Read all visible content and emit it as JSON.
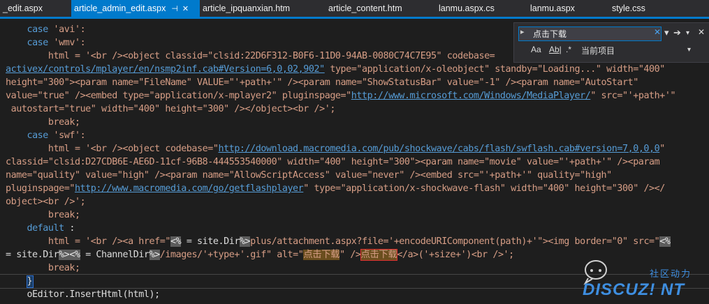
{
  "tabs": [
    {
      "label": "_edit.aspx",
      "active": false
    },
    {
      "label": "article_admin_edit.aspx",
      "active": true,
      "pin": "⊣",
      "close": "✕"
    },
    {
      "label": "article_ipquanxian.htm",
      "active": false
    },
    {
      "label": "article_content.htm",
      "active": false
    },
    {
      "label": "lanmu.aspx.cs",
      "active": false
    },
    {
      "label": "lanmu.aspx",
      "active": false
    },
    {
      "label": "style.css",
      "active": false
    }
  ],
  "find": {
    "value": "点击下载",
    "clear": "✕",
    "dropdown": "▾",
    "next": "➔",
    "close": "✕",
    "options": [
      "Aa",
      "Ab|",
      ".*"
    ],
    "scope": "当前项目",
    "scope_arrow": "▾"
  },
  "code": {
    "l1": [
      "    ",
      "case",
      " 'avi':"
    ],
    "l2": [
      "    ",
      "case",
      " 'wmv':"
    ],
    "l3": [
      "        html = '<br /><object classid=\"clsid:22D6F312-B0F6-11D0-94AB-0080C74C7E95\" codebase="
    ],
    "l4": [
      "activex/controls/mplayer/en/nsmp2inf.cab#Version=6,0,02,902\"",
      " type=\"application/x-oleobject\" standby=\"Loading...\" width=\"400\""
    ],
    "l5": [
      "height=\"300\"><param name=\"FileName\" VALUE=\"'+path+'\" /><param name=\"ShowStatusBar\" value=\"-1\" /><param name=\"AutoStart\""
    ],
    "l6a": "value=\"true\" /><embed type=\"application/x-mplayer2\" pluginspage=\"",
    "l6url": "http://www.microsoft.com/Windows/MediaPlayer/",
    "l6b": "\" src=\"'+path+'\"",
    "l7": " autostart=\"true\" width=\"400\" height=\"300\" /></object><br />';",
    "l8": "        break;",
    "l9": [
      "    ",
      "case",
      " 'swf':"
    ],
    "l10a": "        html = '<br /><object codebase=\"",
    "l10url": "http://download.macromedia.com/pub/shockwave/cabs/flash/swflash.cab#version=7,0,0,0",
    "l10b": "\"",
    "l11": "classid=\"clsid:D27CDB6E-AE6D-11cf-96B8-444553540000\" width=\"400\" height=\"300\"><param name=\"movie\" value=\"'+path+'\" /><param",
    "l12": "name=\"quality\" value=\"high\" /><param name=\"AllowScriptAccess\" value=\"never\" /><embed src=\"'+path+'\" quality=\"high\"",
    "l13a": "pluginspage=\"",
    "l13url": "http://www.macromedia.com/go/getflashplayer",
    "l13b": "\" type=\"application/x-shockwave-flash\" width=\"400\" height=\"300\" /></",
    "l14": "object><br />';",
    "l15": "        break;",
    "l16": [
      "    ",
      "default",
      " :"
    ],
    "l17a": "        html = '<br /><a href=\"",
    "l17s1": "<%",
    "l17b": " = site.Dir",
    "l17s2": "%>",
    "l17c": "plus/attachment.aspx?file='+encodeURIComponent(path)+'\"><img border=\"0\" src=\"",
    "l17s3": "<%",
    "l18a": "= site.Dir",
    "l18s1": "%>",
    "l18s2": "<%",
    "l18b": " = ChannelDir",
    "l18s3": "%>",
    "l18c": "/images/'+type+'.gif\" alt=\"",
    "l18h1": "点击下载",
    "l18d": "\" />",
    "l18h2": "点击下载",
    "l18e": "</a>('+size+')<br />';",
    "l19": "        break;",
    "l20": "    }",
    "l21": "    oEditor.InsertHtml(html);"
  },
  "watermark": {
    "line1": "社区动力",
    "line2": "DISCUZ! NT"
  }
}
